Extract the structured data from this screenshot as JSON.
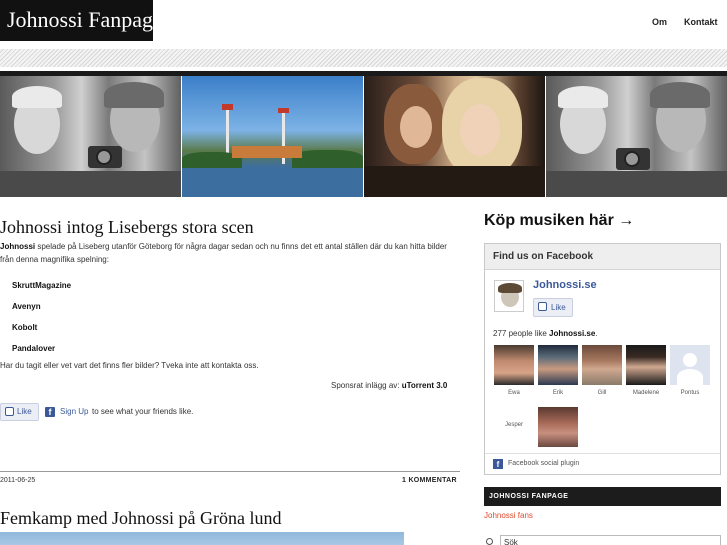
{
  "header": {
    "site_title": "Johnossi Fanpage",
    "nav": [
      "Om",
      "Kontakt"
    ]
  },
  "banner": {
    "images": [
      "band-portrait-left",
      "amusement-park",
      "two-women",
      "band-portrait-right"
    ]
  },
  "post1": {
    "title": "Johnossi intog Lisebergs stora scen",
    "intro_bold": "Johnossi",
    "intro_rest": " spelade på Liseberg utanför Göteborg för några dagar sedan och nu finns det ett antal ställen där du kan hitta bilder från denna magnifika spelning:",
    "links": [
      "SkruttMagazine",
      "Avenyn",
      "Kobolt",
      "Pandalover"
    ],
    "outro": "Har du tagit eller vet vart det finns fler bilder? Tveka inte att kontakta oss.",
    "sponsor_label": "Sponsrat inlägg av: ",
    "sponsor_link": "uTorrent 3.0",
    "like_label": "Like",
    "signup_link": "Sign Up",
    "signup_rest": " to see what your friends like.",
    "date": "2011-06-25",
    "comments": "1 KOMMENTAR"
  },
  "post2": {
    "title": "Femkamp med Johnossi på Gröna lund"
  },
  "sidebar": {
    "buy_heading": "Köp musiken här →",
    "facebook": {
      "header": "Find us on Facebook",
      "page_name": "Johnossi.se",
      "like_label": "Like",
      "count_prefix": "277 people like ",
      "count_page": "Johnossi.se",
      "count_suffix": ".",
      "fans": [
        "Ewa",
        "Erik",
        "Gill",
        "Madelene",
        "Pontus",
        "Jesper"
      ],
      "plugin_label": "Facebook social plugin"
    },
    "widget_heading": "JOHNOSSI FANPAGE",
    "widget_link": "Johnossi fans",
    "search_value": "Sök"
  },
  "colors": {
    "facebook_blue": "#3b5998",
    "link_red": "#e04a2f",
    "dark": "#1c1c1c"
  }
}
